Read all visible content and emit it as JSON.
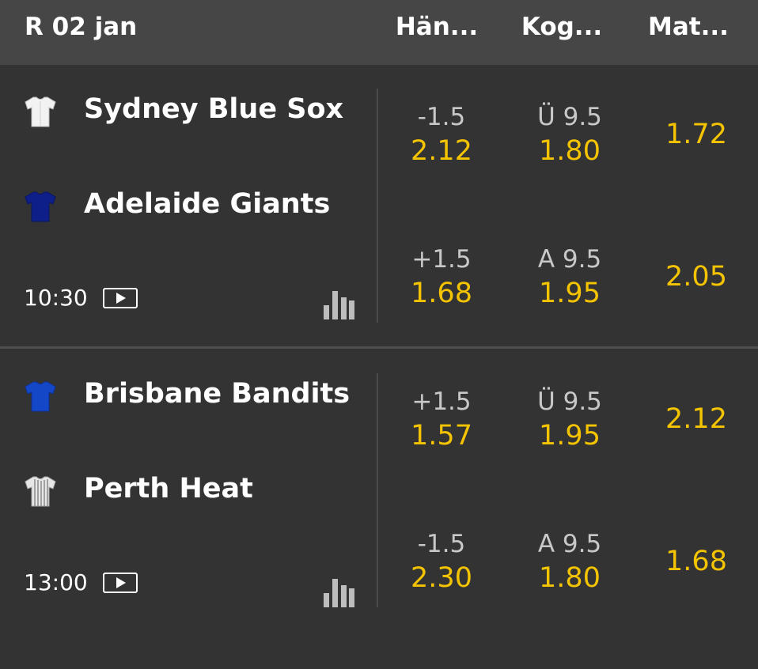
{
  "header": {
    "date": "R 02 jan",
    "columns": [
      "Hän...",
      "Kog...",
      "Mat..."
    ]
  },
  "events": [
    {
      "time": "10:30",
      "teams": [
        {
          "name": "Sydney Blue Sox",
          "jersey_icon": "white-jersey-icon",
          "jersey_color": "#f2f2f2"
        },
        {
          "name": "Adelaide Giants",
          "jersey_icon": "navy-jersey-icon",
          "jersey_color": "#0f1f8a"
        }
      ],
      "handicap": [
        {
          "line": "-1.5",
          "odds": "2.12"
        },
        {
          "line": "+1.5",
          "odds": "1.68"
        }
      ],
      "total": [
        {
          "line": "Ü 9.5",
          "odds": "1.80"
        },
        {
          "line": "A 9.5",
          "odds": "1.95"
        }
      ],
      "match": [
        "1.72",
        "2.05"
      ]
    },
    {
      "time": "13:00",
      "teams": [
        {
          "name": "Brisbane Bandits",
          "jersey_icon": "blue-jersey-icon",
          "jersey_color": "#1446c8"
        },
        {
          "name": "Perth Heat",
          "jersey_icon": "striped-jersey-icon",
          "jersey_color": "#dcdcdc"
        }
      ],
      "handicap": [
        {
          "line": "+1.5",
          "odds": "1.57"
        },
        {
          "line": "-1.5",
          "odds": "2.30"
        }
      ],
      "total": [
        {
          "line": "Ü 9.5",
          "odds": "1.95"
        },
        {
          "line": "A 9.5",
          "odds": "1.80"
        }
      ],
      "match": [
        "2.12",
        "1.68"
      ]
    }
  ],
  "colors": {
    "odds": "#f5c400",
    "background": "#333333",
    "header_background": "#464646"
  }
}
